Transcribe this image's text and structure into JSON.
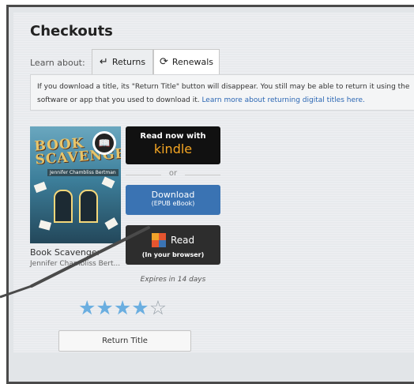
{
  "page": {
    "title": "Checkouts",
    "learn_about_label": "Learn about:",
    "tabs": [
      {
        "label": "Returns",
        "icon": "return-arrow-icon",
        "selected": true
      },
      {
        "label": "Renewals",
        "icon": "refresh-icon",
        "selected": false
      }
    ]
  },
  "info": {
    "text": "If you download a title, its \"Return Title\" button will disappear. You still may be able to return it using the software or app that you used to download it. ",
    "link": "Learn more about returning digital titles here."
  },
  "book": {
    "cover_title": "BOOK SCAVENGER",
    "cover_author": "Jennifer Chambliss Bertman",
    "name": "Book Scavenger",
    "author": "Jennifer Chambliss Bert...",
    "badge_icon": "open-book-icon"
  },
  "actions": {
    "kindle_line1": "Read now with",
    "kindle_line2": "kindle",
    "or": "or",
    "download_line1": "Download",
    "download_line2": "(EPUB eBook)",
    "read_line1": "Read",
    "read_line2": "(In your browser)",
    "expires": "Expires in 14 days",
    "return_label": "Return Title"
  },
  "rating": {
    "value": 4,
    "max": 5
  },
  "colors": {
    "download_blue": "#3a73b3",
    "kindle_orange": "#f5a623",
    "star_blue": "#6aaee0",
    "link_blue": "#2a66b3"
  }
}
